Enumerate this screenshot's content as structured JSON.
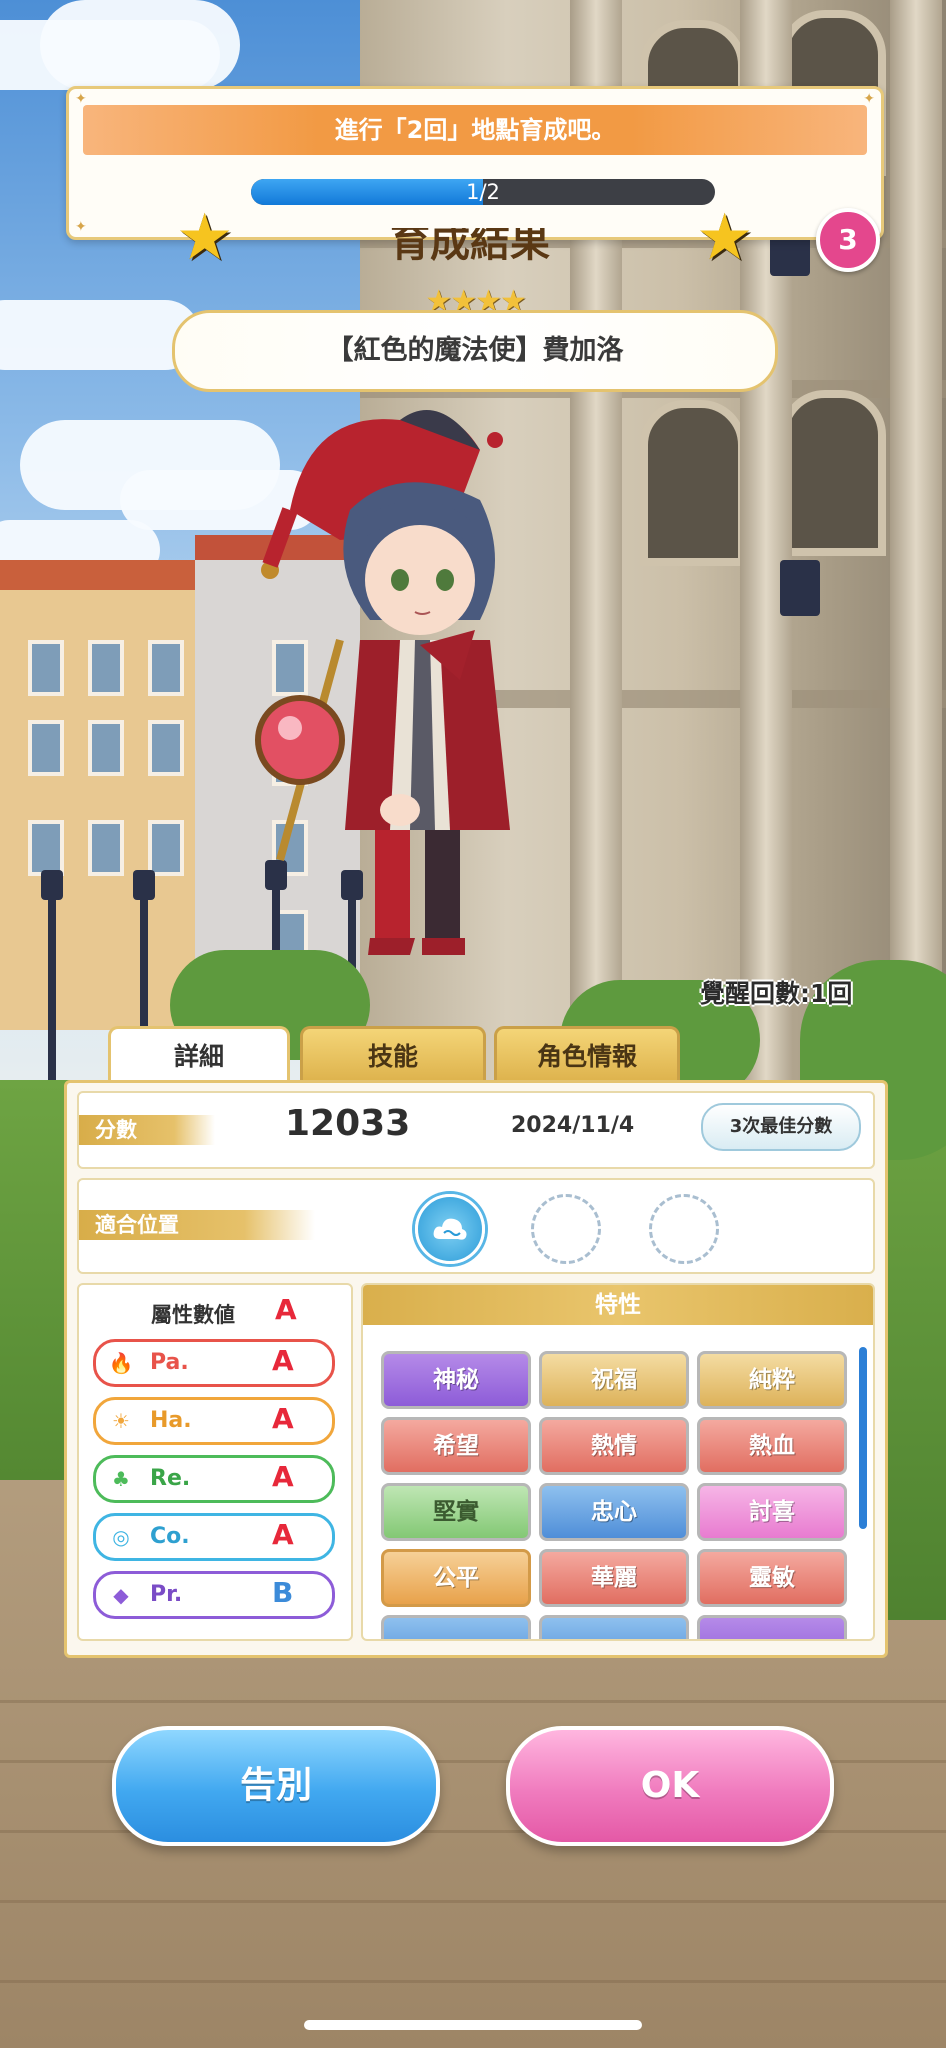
{
  "quest": {
    "text": "進行「2回」地點育成吧。",
    "progress_text": "1/2",
    "progress_fraction": 0.5
  },
  "notification_badge": "3",
  "result_title": "育成結果",
  "rarity_stars": "★★★★",
  "character_name": "【紅色的魔法使】費加洛",
  "awaken_count": "覺醒回數:1回",
  "tabs": [
    "詳細",
    "技能",
    "角色情報"
  ],
  "score": {
    "label": "分數",
    "value": "12033",
    "date": "2024/11/4",
    "best_button": "3次最佳分數"
  },
  "position": {
    "label": "適合位置"
  },
  "attributes": {
    "header": "屬性數値",
    "overall_grade": "A",
    "items": [
      {
        "name": "Pa.",
        "grade": "A",
        "icon": "flame-icon",
        "color": "#e8534a"
      },
      {
        "name": "Ha.",
        "grade": "A",
        "icon": "sun-icon",
        "color": "#f1a63b"
      },
      {
        "name": "Re.",
        "grade": "A",
        "icon": "clover-icon",
        "color": "#4dbb5a"
      },
      {
        "name": "Co.",
        "grade": "A",
        "icon": "swirl-icon",
        "color": "#3fb5e3"
      },
      {
        "name": "Pr.",
        "grade": "B",
        "icon": "diamond-icon",
        "color": "#8d5cd8"
      }
    ]
  },
  "traits": {
    "header": "特性",
    "items": [
      "神秘",
      "祝福",
      "純粋",
      "希望",
      "熱情",
      "熱血",
      "堅實",
      "忠心",
      "討喜",
      "公平",
      "華麗",
      "靈敏"
    ]
  },
  "buttons": {
    "farewell": "告別",
    "ok": "OK"
  },
  "colors": {
    "accent_gold": "#e4c36f",
    "blue_button": "#41a8f0",
    "pink_button": "#f07bbe",
    "badge": "#e4478d"
  }
}
